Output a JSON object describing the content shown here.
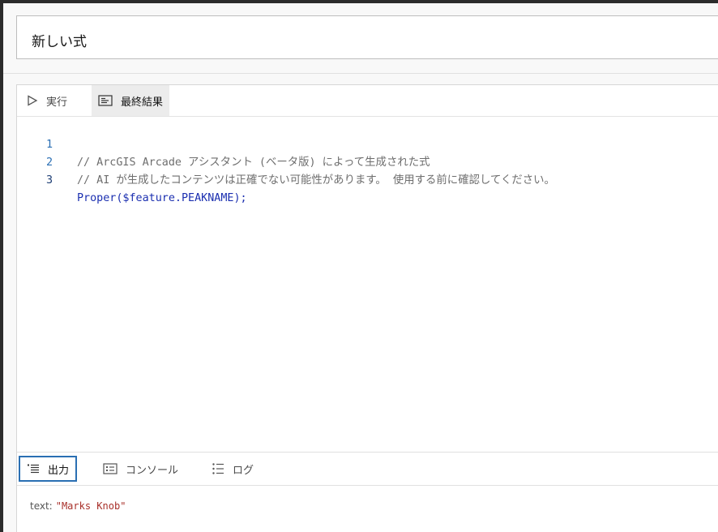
{
  "title": "新しい式",
  "toolbar": {
    "run_label": "実行",
    "result_label": "最終結果"
  },
  "editor": {
    "lines": [
      {
        "number": "1",
        "text": "// ArcGIS Arcade アシスタント (ベータ版) によって生成された式"
      },
      {
        "number": "2",
        "text": "// AI が生成したコンテンツは正確でない可能性があります。 使用する前に確認してください。"
      },
      {
        "number": "3",
        "text": "Proper($feature.PEAKNAME);"
      }
    ]
  },
  "output_tabs": {
    "output_label": "出力",
    "console_label": "コンソール",
    "log_label": "ログ"
  },
  "output": {
    "key": "text:",
    "value": "\"Marks Knob\""
  },
  "icons": {
    "run": "play-icon",
    "result": "result-icon",
    "output": "list-icon",
    "console": "console-icon",
    "log": "log-icon"
  },
  "colors": {
    "accent": "#2a6fb3",
    "code_keyword": "#1b2fb0",
    "comment": "#6e6e6e",
    "string": "#a8302a"
  }
}
